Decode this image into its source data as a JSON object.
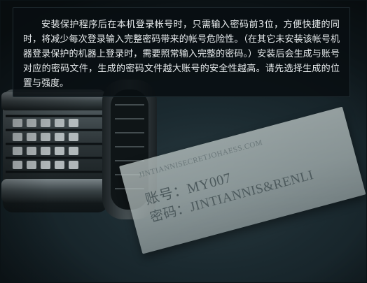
{
  "info": {
    "description": "安装保护程序后在本机登录帐号时，只需输入密码前3位，方便快捷的同时，将减少每次登录输入完整密码带来的帐号危险性。（在其它未安装该帐号机器登录保护的机器上登录时，需要照常输入完整的密码。）安装后会生成与账号对应的密码文件，生成的密码文件越大账号的安全性越高。请先选择生成的位置与强度。"
  },
  "paper": {
    "url": "JINTIANNISECRETJOHAESS.COM",
    "account": "账号：MY007",
    "password": "密码：JINTIANNIS&RENLI"
  },
  "colors": {
    "background": "#1b2a30",
    "panel": "#080e11",
    "text": "#e8ecee"
  }
}
